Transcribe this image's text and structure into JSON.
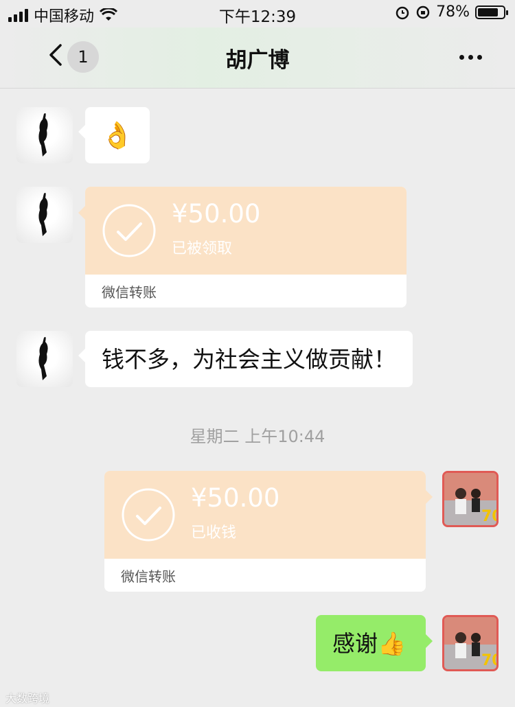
{
  "status_bar": {
    "carrier": "中国移动",
    "time": "下午12:39",
    "battery": "78%"
  },
  "nav": {
    "back_icon": "chevron-left-icon",
    "unread_count": "1",
    "title": "胡广博",
    "more_icon": "more-dots-icon"
  },
  "messages": {
    "m1": {
      "emoji": "👌"
    },
    "m2": {
      "amount": "¥50.00",
      "status": "已被领取",
      "source": "微信转账"
    },
    "m3": {
      "text": "钱不多，为社会主义做贡献！"
    },
    "timestamp": "星期二 上午10:44",
    "m4": {
      "amount": "¥50.00",
      "status": "已收钱",
      "source": "微信转账"
    },
    "m5": {
      "text": "感谢👍"
    }
  },
  "watermark": "大数跨境",
  "colors": {
    "background": "#ededed",
    "transfer_peach": "#fbe2c6",
    "green_bubble": "#95ec69"
  }
}
